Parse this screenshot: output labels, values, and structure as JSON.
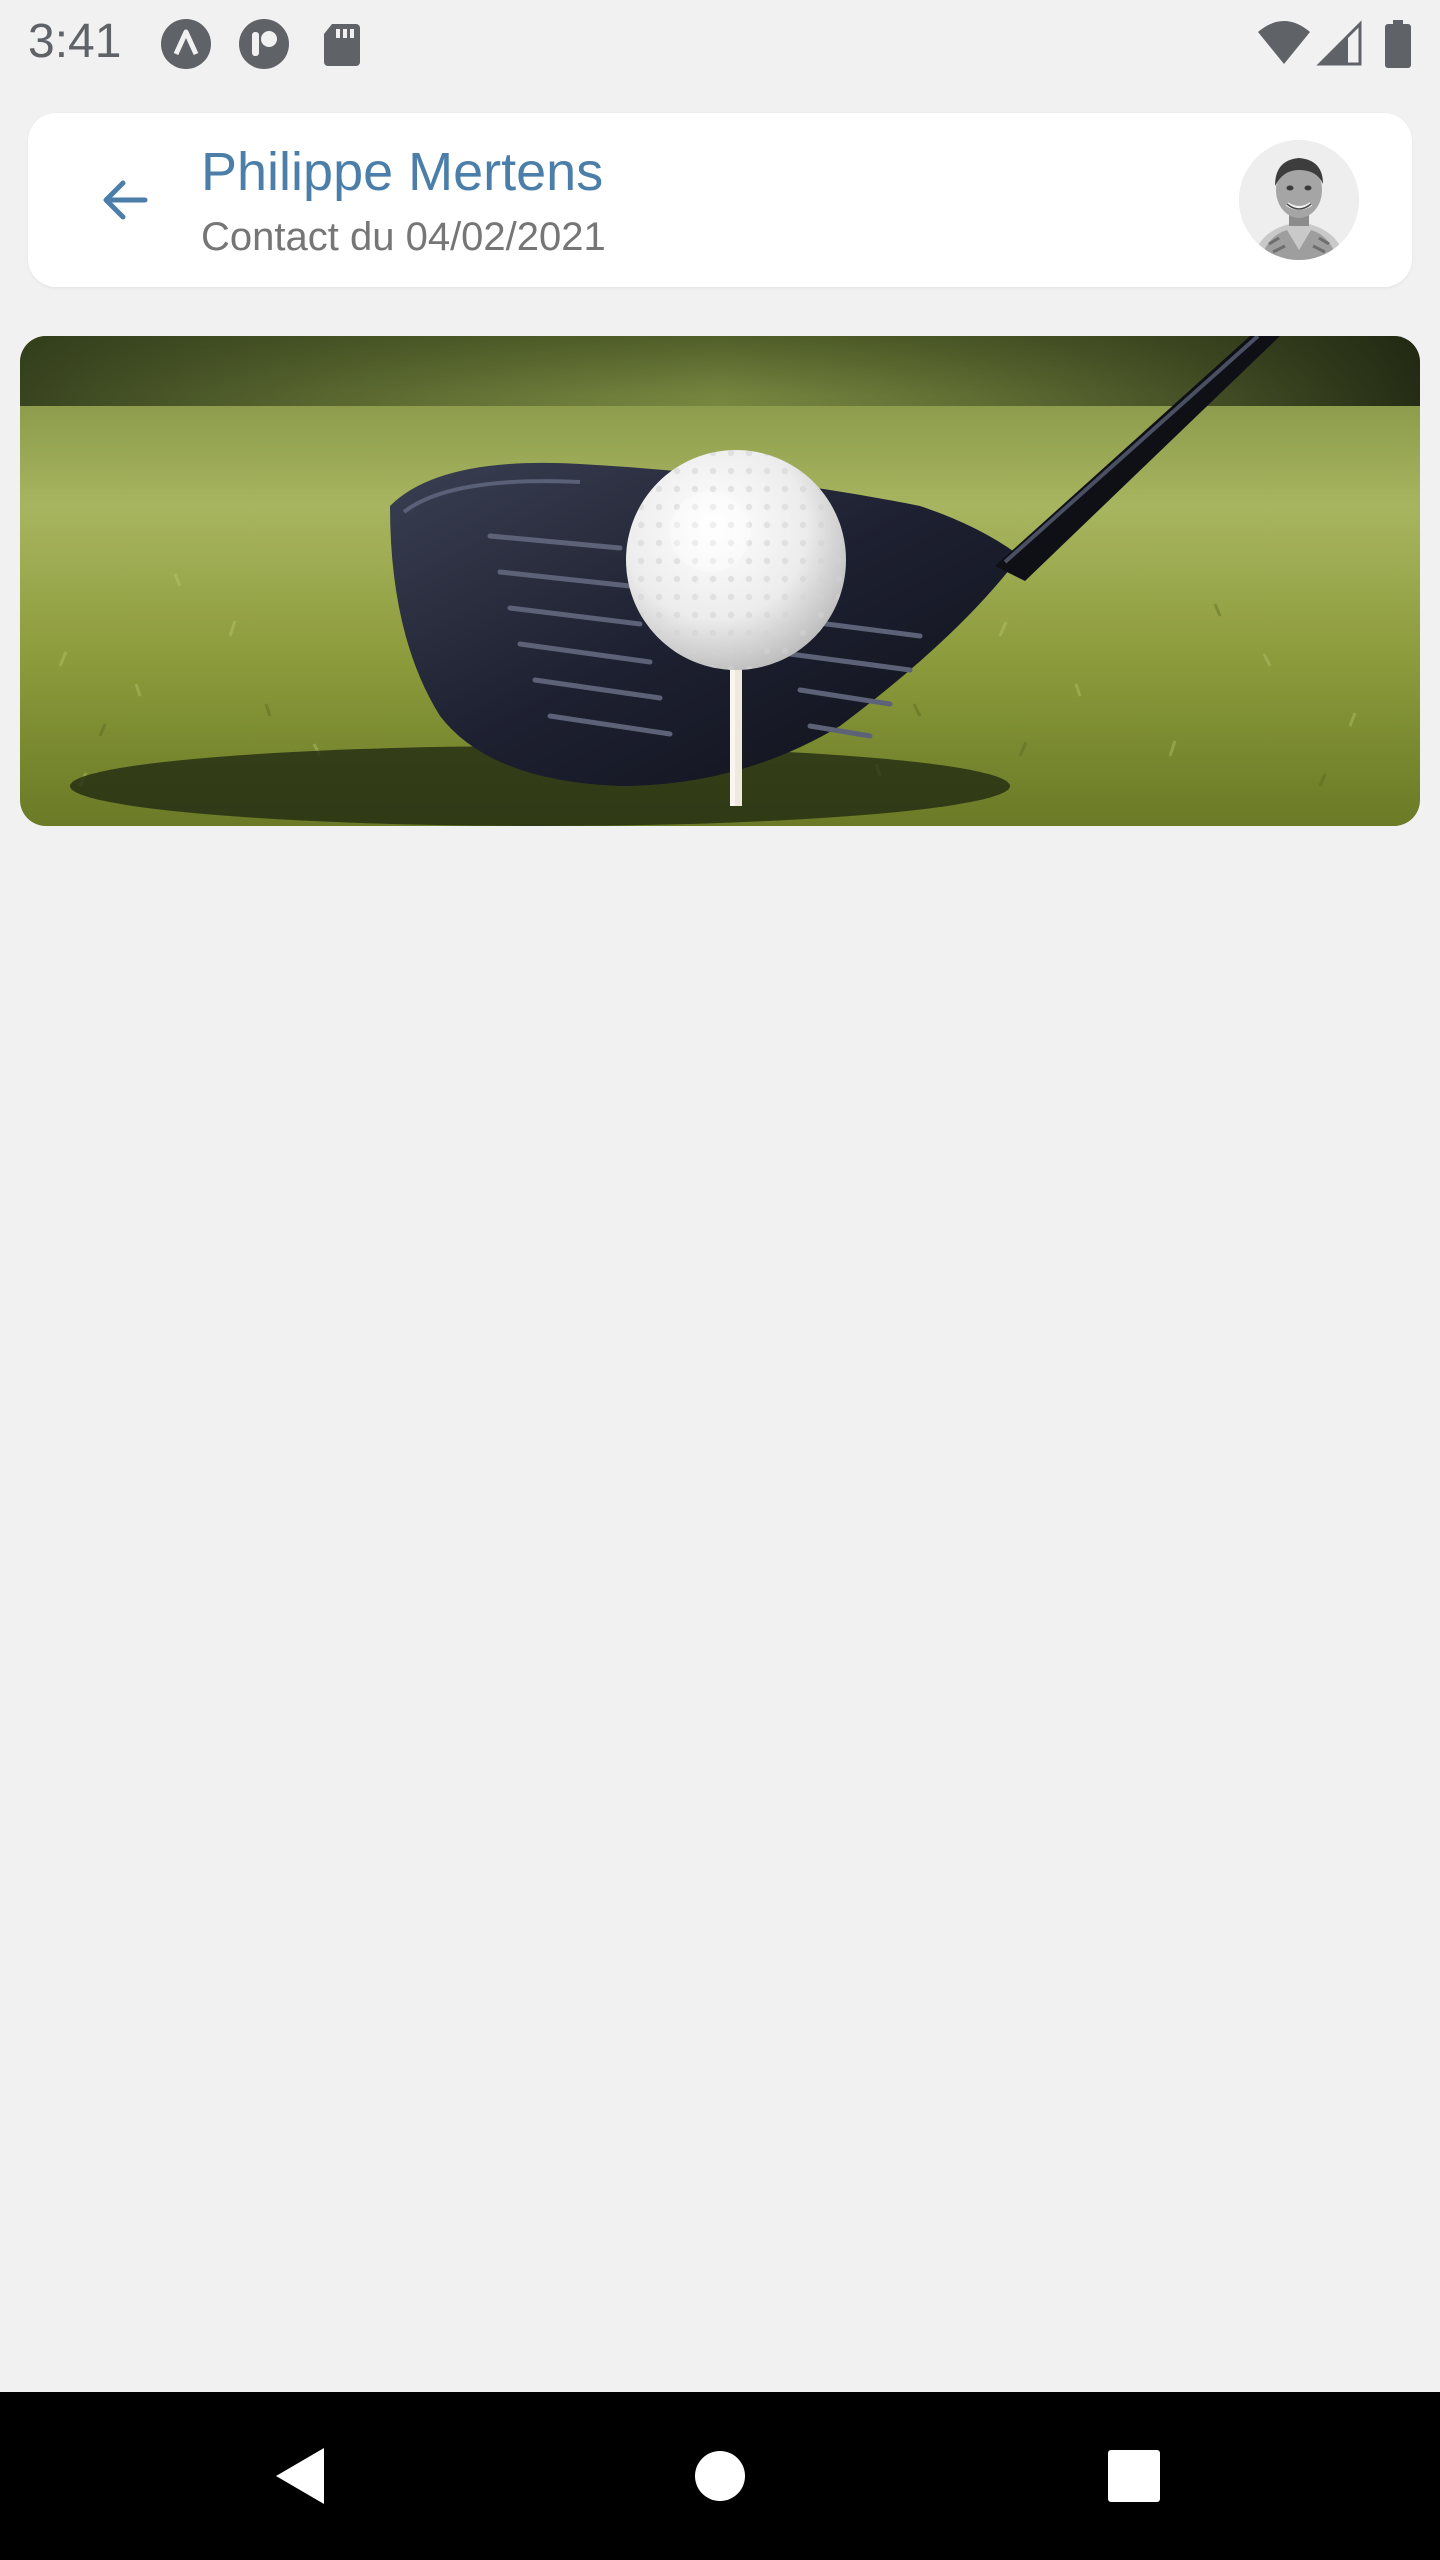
{
  "status_bar": {
    "time": "3:41",
    "left_icons": [
      "arrow-notification-icon",
      "app-notification-icon",
      "sd-card-icon"
    ],
    "right_icons": [
      "wifi-icon",
      "cell-signal-icon",
      "battery-icon"
    ]
  },
  "header": {
    "name": "Philippe Mertens",
    "subtitle": "Contact du 04/02/2021",
    "back_icon": "arrow-left-icon",
    "avatar_icon": "profile-photo"
  },
  "content": {
    "image_icon": "golf-ball-driver-photo"
  },
  "nav_bar": {
    "icons": [
      "back-triangle-icon",
      "home-circle-icon",
      "recents-square-icon"
    ]
  },
  "colors": {
    "accent": "#4b7ea8",
    "subtitle": "#767676",
    "background": "#f1f1f1",
    "card": "#ffffff",
    "nav_bar": "#000000"
  }
}
